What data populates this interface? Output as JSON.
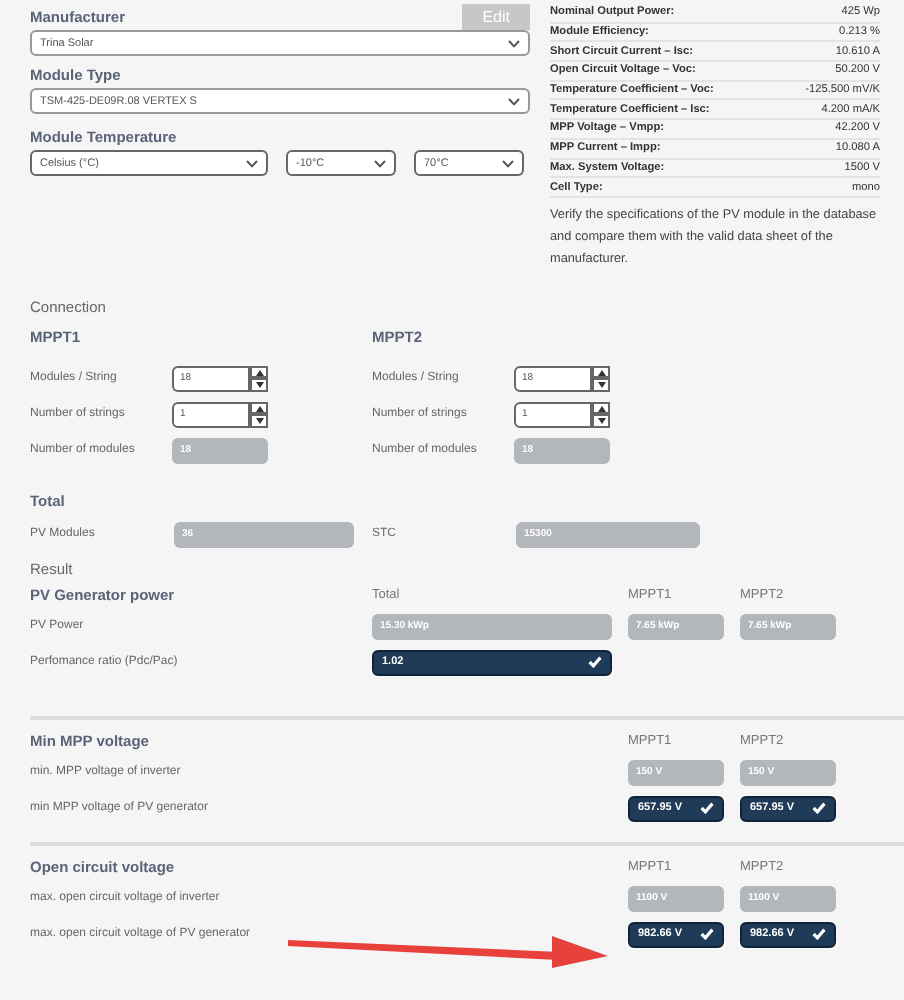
{
  "module": {
    "manufacturer": {
      "label": "Manufacturer",
      "value": "Trina Solar"
    },
    "edit_button": {
      "label": "Edit",
      "disabled": true
    },
    "module_type": {
      "label": "Module Type",
      "value": "TSM-425-DE09R.08 VERTEX S"
    },
    "temperature": {
      "label": "Module Temperature",
      "unit": "Celsius (°C)",
      "min": "-10°C",
      "max": "70°C"
    }
  },
  "specs": [
    {
      "name": "Nominal Output Power:",
      "value": "425 Wp"
    },
    {
      "name": "Module Efficiency:",
      "value": "0.213 %"
    },
    {
      "name": "Short Circuit Current – Isc:",
      "value": "10.610 A"
    },
    {
      "name": "Open Circuit Voltage – Voc:",
      "value": "50.200 V"
    },
    {
      "name": "Temperature Coefficient – Voc:",
      "value": "-125.500 mV/K"
    },
    {
      "name": "Temperature Coefficient – Isc:",
      "value": "4.200 mA/K"
    },
    {
      "name": "MPP Voltage – Vmpp:",
      "value": "42.200 V"
    },
    {
      "name": "MPP Current – Impp:",
      "value": "10.080 A"
    },
    {
      "name": "Max. System Voltage:",
      "value": "1500 V"
    },
    {
      "name": "Cell Type:",
      "value": "mono"
    }
  ],
  "note": "Verify the specifications of the PV module in the database and compare them with the valid data sheet of the manufacturer.",
  "connection": {
    "title": "Connection",
    "mppts": [
      {
        "title": "MPPT1",
        "rows": [
          {
            "label": "Modules / String",
            "value": "18",
            "kind": "spinner"
          },
          {
            "label": "Number of strings",
            "value": "1",
            "kind": "spinner"
          },
          {
            "label": "Number of modules",
            "value": "18",
            "kind": "readonly"
          }
        ]
      },
      {
        "title": "MPPT2",
        "rows": [
          {
            "label": "Modules / String",
            "value": "18",
            "kind": "spinner"
          },
          {
            "label": "Number of strings",
            "value": "1",
            "kind": "spinner"
          },
          {
            "label": "Number of modules",
            "value": "18",
            "kind": "readonly"
          }
        ]
      }
    ]
  },
  "total": {
    "title": "Total",
    "fields": [
      {
        "label": "PV Modules",
        "value": "36"
      },
      {
        "label": "STC",
        "value": "15300"
      }
    ]
  },
  "result": {
    "title": "Result",
    "subtitle": "PV Generator power",
    "columns": [
      "Total",
      "MPPT1",
      "MPPT2"
    ],
    "rows": [
      {
        "label": "PV Power",
        "values": [
          {
            "value": "15.30 kWp",
            "valid": false
          },
          {
            "value": "7.65 kWp",
            "valid": false
          },
          {
            "value": "7.65 kWp",
            "valid": false
          }
        ]
      },
      {
        "label": "Perfomance ratio (Pdc/Pac)",
        "values": [
          {
            "value": "1.02",
            "valid": true
          }
        ]
      }
    ]
  },
  "checks": [
    {
      "title": "Min MPP voltage",
      "columns": [
        "MPPT1",
        "MPPT2"
      ],
      "rows": [
        {
          "label": "min. MPP voltage of inverter",
          "values": [
            {
              "value": "150 V",
              "valid": false
            },
            {
              "value": "150 V",
              "valid": false
            }
          ]
        },
        {
          "label": "min MPP voltage of PV generator",
          "values": [
            {
              "value": "657.95 V",
              "valid": true
            },
            {
              "value": "657.95 V",
              "valid": true
            }
          ]
        }
      ]
    },
    {
      "title": "Open circuit voltage",
      "columns": [
        "MPPT1",
        "MPPT2"
      ],
      "rows": [
        {
          "label": "max. open circuit voltage of inverter",
          "values": [
            {
              "value": "1100 V",
              "valid": false
            },
            {
              "value": "1100 V",
              "valid": false
            }
          ]
        },
        {
          "label": "max. open circuit voltage of PV generator",
          "values": [
            {
              "value": "982.66 V",
              "valid": true
            },
            {
              "value": "982.66 V",
              "valid": true
            }
          ]
        }
      ]
    }
  ]
}
